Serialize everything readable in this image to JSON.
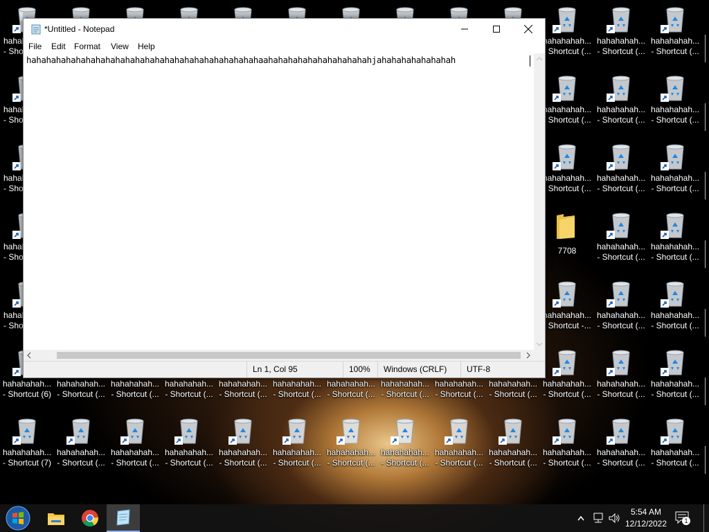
{
  "window": {
    "title": "*Untitled - Notepad",
    "menu": [
      "File",
      "Edit",
      "Format",
      "View",
      "Help"
    ],
    "content": "hahahahahahahahahahahahahahahahahahahahahahahahaahahahahahahahahahahahjahahahahahahahah"
  },
  "status": {
    "position": "Ln 1, Col 95",
    "zoom": "100%",
    "line_ending": "Windows (CRLF)",
    "encoding": "UTF-8"
  },
  "desktop": {
    "row_top": [
      {
        "l1": "hahahahah...",
        "l2": "- Shortcut (..."
      },
      {
        "l1": "hahahahah...",
        "l2": "- Shortcut (..."
      },
      {
        "l1": "hahahahah...",
        "l2": "- Shortcut (..."
      }
    ],
    "row6_labels": [
      {
        "l1": "hahahahah...",
        "l2": "- Shortcut (6)"
      },
      {
        "l1": "hahahahah...",
        "l2": "- Shortcut (..."
      },
      {
        "l1": "hahahahah...",
        "l2": "- Shortcut (..."
      },
      {
        "l1": "hahahahah...",
        "l2": "- Shortcut (..."
      },
      {
        "l1": "hahahahah...",
        "l2": "- Shortcut (..."
      },
      {
        "l1": "hahahahah...",
        "l2": "- Shortcut (..."
      },
      {
        "l1": "hahahahah...",
        "l2": "- Shortcut (..."
      },
      {
        "l1": "hahahahah...",
        "l2": "- Shortcut (..."
      },
      {
        "l1": "hahahahah...",
        "l2": "- Shortcut (..."
      },
      {
        "l1": "hahahahah...",
        "l2": "- Shortcut (..."
      },
      {
        "l1": "hahahahah...",
        "l2": "- Shortcut (..."
      },
      {
        "l1": "hahahahah...",
        "l2": "- Shortcut (..."
      },
      {
        "l1": "hahahahah...",
        "l2": "- Shortcut (..."
      }
    ],
    "row7_labels": [
      {
        "l1": "hahahahah...",
        "l2": "- Shortcut (7)"
      },
      {
        "l1": "hahahahah...",
        "l2": "- Shortcut (..."
      },
      {
        "l1": "hahahahah...",
        "l2": "- Shortcut (..."
      },
      {
        "l1": "hahahahah...",
        "l2": "- Shortcut (..."
      },
      {
        "l1": "hahahahah...",
        "l2": "- Shortcut (..."
      },
      {
        "l1": "hahahahah...",
        "l2": "- Shortcut (..."
      },
      {
        "l1": "hahahahah...",
        "l2": "- Shortcut (..."
      },
      {
        "l1": "hahahahah...",
        "l2": "- Shortcut (..."
      },
      {
        "l1": "hahahahah...",
        "l2": "- Shortcut (..."
      },
      {
        "l1": "hahahahah...",
        "l2": "- Shortcut (..."
      },
      {
        "l1": "hahahahah...",
        "l2": "- Shortcut (..."
      },
      {
        "l1": "hahahahah...",
        "l2": "- Shortcut (..."
      },
      {
        "l1": "hahahahah...",
        "l2": "- Shortcut (..."
      }
    ],
    "right_rows": [
      [
        "hahahahah...",
        "- Shortcut (..."
      ],
      [
        "hahahahah...",
        "- Shortcut (..."
      ],
      [
        "hahahahah...",
        "- Shortcut (..."
      ],
      [
        "hahahahah...",
        "- Shortcut (..."
      ],
      [
        "hahahahah...",
        "- Shortcut -..."
      ]
    ],
    "left_cut": {
      "l1": "hahal",
      "l2": "- Sho"
    },
    "folder_label": "7708"
  },
  "taskbar": {
    "time": "5:54 AM",
    "date": "12/12/2022",
    "notification_count": "1"
  }
}
